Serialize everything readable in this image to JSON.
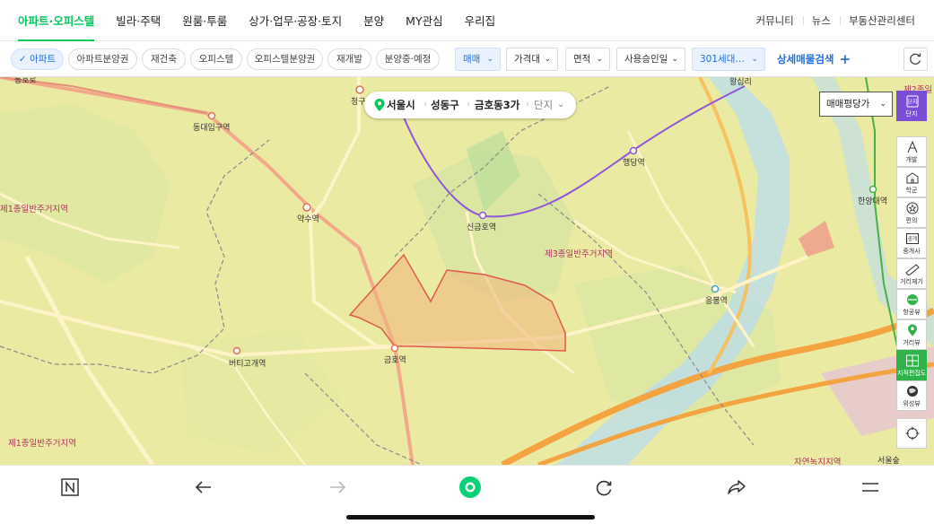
{
  "topnav": {
    "menu": [
      {
        "label": "아파트·오피스텔",
        "active": true
      },
      {
        "label": "빌라·주택"
      },
      {
        "label": "원룸·투룸"
      },
      {
        "label": "상가·업무·공장·토지"
      },
      {
        "label": "분양"
      },
      {
        "label": "MY관심"
      },
      {
        "label": "우리집"
      }
    ],
    "right": [
      "커뮤니티",
      "뉴스",
      "부동산관리센터"
    ]
  },
  "filters": {
    "chips": [
      "아파트",
      "아파트분양권",
      "재건축",
      "오피스텔",
      "오피스텔분양권",
      "재개발",
      "분양중·예정"
    ],
    "dropdowns": [
      "매매",
      "가격대",
      "면적",
      "사용승인일",
      "301세대…"
    ],
    "advanced_search": "상세매물검색"
  },
  "breadcrumb": {
    "city": "서울시",
    "district": "성동구",
    "dong": "금호동3가",
    "type": "단지"
  },
  "price_select": "매매평당가",
  "tools": [
    {
      "icon": "complex-icon",
      "label": "단지"
    },
    {
      "icon": "development-icon",
      "label": "개발"
    },
    {
      "icon": "school-icon",
      "label": "학군"
    },
    {
      "icon": "amenity-icon",
      "label": "편의"
    },
    {
      "icon": "broker-icon",
      "label": "중개사"
    },
    {
      "icon": "ruler-icon",
      "label": "거리재기"
    },
    {
      "icon": "aerial-view-icon",
      "label": "항공뷰"
    },
    {
      "icon": "street-view-icon",
      "label": "거리뷰"
    },
    {
      "icon": "cadastral-map-icon",
      "label": "지적편집도"
    },
    {
      "icon": "satellite-icon",
      "label": "위성뷰"
    },
    {
      "icon": "my-location-icon",
      "label": ""
    }
  ],
  "map_labels": {
    "stations": [
      "동대입구역",
      "약수역",
      "버티고개역",
      "금호역",
      "신금호역",
      "행당역",
      "응봉역",
      "한양대역",
      "서울숲"
    ],
    "zones": [
      "제1종일반주거지역",
      "제1종일반주거지역",
      "제3종일반주거지역",
      "자연녹지지역",
      "제2종일"
    ],
    "partial": [
      "청구",
      "왕십리",
      "동호로"
    ]
  },
  "colors": {
    "accent_green": "#03c75a",
    "accent_blue": "#1f6fe0",
    "purple": "#7a4fd6",
    "map_base": "#eaeaa2",
    "boundary": "#e05a4a"
  }
}
